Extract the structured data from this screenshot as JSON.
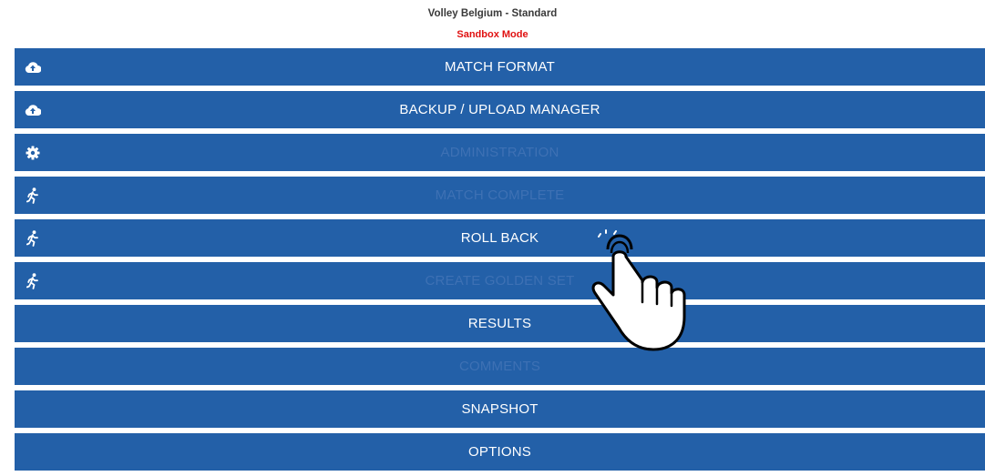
{
  "header": {
    "title": "Volley Belgium - Standard",
    "mode": "Sandbox Mode"
  },
  "colors": {
    "button_bg": "#2360a8",
    "label": "#ffffff",
    "label_disabled": "#3e71b4",
    "mode_text": "#e01010"
  },
  "menu": {
    "items": [
      {
        "label": "MATCH FORMAT",
        "icon": "cloud-upload-icon",
        "enabled": true
      },
      {
        "label": "BACKUP / UPLOAD MANAGER",
        "icon": "cloud-upload-icon",
        "enabled": true
      },
      {
        "label": "ADMINISTRATION",
        "icon": "gear-icon",
        "enabled": false
      },
      {
        "label": "MATCH COMPLETE",
        "icon": "running-person-icon",
        "enabled": false
      },
      {
        "label": "ROLL BACK",
        "icon": "running-person-icon",
        "enabled": true
      },
      {
        "label": "CREATE GOLDEN SET",
        "icon": "running-person-icon",
        "enabled": false
      },
      {
        "label": "RESULTS",
        "icon": null,
        "enabled": true
      },
      {
        "label": "COMMENTS",
        "icon": null,
        "enabled": false
      },
      {
        "label": "SNAPSHOT",
        "icon": null,
        "enabled": true
      },
      {
        "label": "OPTIONS",
        "icon": null,
        "enabled": true
      }
    ]
  },
  "overlay": {
    "icon": "tap-hand-icon"
  }
}
